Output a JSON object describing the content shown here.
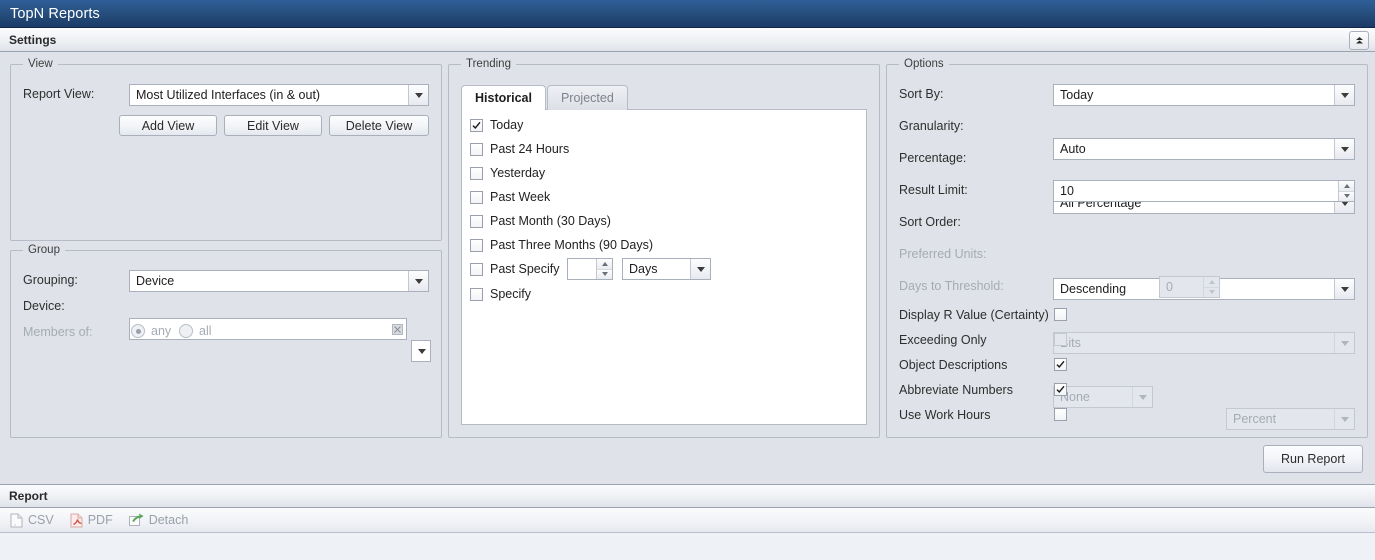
{
  "window": {
    "title": "TopN Reports"
  },
  "settings": {
    "header_label": "Settings",
    "collapse_icon": "chevron-up-icon"
  },
  "view_group": {
    "legend": "View",
    "report_view_label": "Report View:",
    "report_view_value": "Most Utilized Interfaces (in & out)",
    "buttons": [
      {
        "label": "Add View"
      },
      {
        "label": "Edit View"
      },
      {
        "label": "Delete View"
      }
    ]
  },
  "group_group": {
    "legend": "Group",
    "grouping_label": "Grouping:",
    "grouping_value": "Device",
    "device_label": "Device:",
    "device_value": "",
    "device_clear_icon": "clear-x-icon",
    "members_label": "Members of:",
    "members_options": [
      {
        "label": "any",
        "selected": true
      },
      {
        "label": "all",
        "selected": false
      }
    ]
  },
  "trending": {
    "legend": "Trending",
    "tabs": [
      {
        "label": "Historical",
        "active": true
      },
      {
        "label": "Projected",
        "active": false
      }
    ],
    "items": [
      {
        "label": "Today",
        "checked": true
      },
      {
        "label": "Past 24 Hours",
        "checked": false
      },
      {
        "label": "Yesterday",
        "checked": false
      },
      {
        "label": "Past Week",
        "checked": false
      },
      {
        "label": "Past Month (30 Days)",
        "checked": false
      },
      {
        "label": "Past Three Months (90 Days)",
        "checked": false
      },
      {
        "label": "Past Specify",
        "checked": false
      },
      {
        "label": "Specify",
        "checked": false
      }
    ],
    "past_specify_amount": "",
    "past_specify_unit": "Days"
  },
  "options": {
    "legend": "Options",
    "sort_by_label": "Sort By:",
    "sort_by_value": "Today",
    "granularity_label": "Granularity:",
    "granularity_value": "Auto",
    "percentage_label": "Percentage:",
    "percentage_value": "All Percentage",
    "result_limit_label": "Result Limit:",
    "result_limit_value": "10",
    "sort_order_label": "Sort Order:",
    "sort_order_value": "Descending",
    "preferred_units_label": "Preferred Units:",
    "preferred_units_value": "Bits",
    "days_to_threshold_label": "Days to Threshold:",
    "days_to_threshold_mode": "None",
    "days_to_threshold_amount": "0",
    "days_to_threshold_unit": "Percent",
    "checkboxes": [
      {
        "label": "Display R Value (Certainty)",
        "checked": false,
        "disabled": false
      },
      {
        "label": "Exceeding Only",
        "checked": false,
        "disabled": true
      },
      {
        "label": "Object Descriptions",
        "checked": true,
        "disabled": false
      },
      {
        "label": "Abbreviate Numbers",
        "checked": true,
        "disabled": false
      },
      {
        "label": "Use Work Hours",
        "checked": false,
        "disabled": false
      }
    ]
  },
  "actions": {
    "run_report_label": "Run Report"
  },
  "report": {
    "header_label": "Report",
    "toolbar": [
      {
        "label": "CSV",
        "icon": "csv-file-icon"
      },
      {
        "label": "PDF",
        "icon": "pdf-file-icon"
      },
      {
        "label": "Detach",
        "icon": "detach-arrow-icon"
      }
    ]
  },
  "colors": {
    "titlebar_dark": "#1b3b68",
    "titlebar_light": "#2f5f98",
    "panel_bg": "#dfe3e9",
    "border": "#b6bcc6",
    "pdf_red": "#cf4a3f",
    "detach_green": "#5aa85a"
  }
}
